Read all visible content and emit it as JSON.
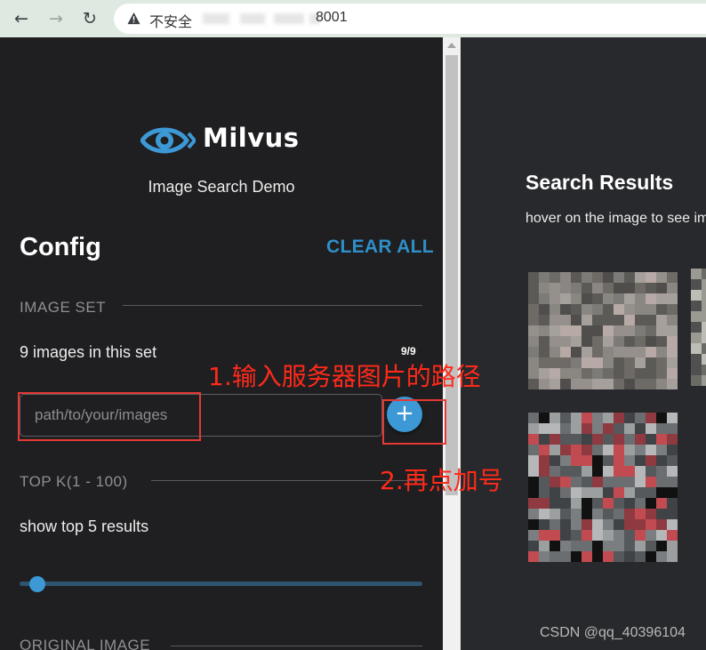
{
  "browser": {
    "back_icon": "←",
    "forward_icon": "→",
    "reload_icon": "↻",
    "insecure_label": "不安全",
    "url_port": "8001"
  },
  "app": {
    "logo_text": "Milvus",
    "subtitle": "Image Search Demo"
  },
  "config": {
    "title": "Config",
    "clear_all": "CLEAR ALL",
    "image_set_label": "IMAGE SET",
    "image_count_text": "9 images in this set",
    "image_count_badge": "9/9",
    "path_placeholder": "path/to/your/images",
    "add_button": "+",
    "top_k_label": "TOP K(1 - 100)",
    "top_k_text": "show top 5 results",
    "top_k_value": 5,
    "top_k_range": [
      1,
      100
    ],
    "original_image_label": "ORIGINAL IMAGE"
  },
  "results": {
    "title": "Search Results",
    "hint": "hover on the image to see image"
  },
  "annotations": {
    "step1": "1.输入服务器图片的路径",
    "step2": "2.再点加号"
  },
  "watermark": "CSDN @qq_40396104",
  "colors": {
    "accent": "#3d99d6",
    "clear_all": "#2f8fc9",
    "annotation": "#ff2a1a",
    "panel_bg": "#1f1f21",
    "results_bg": "#28292c"
  }
}
